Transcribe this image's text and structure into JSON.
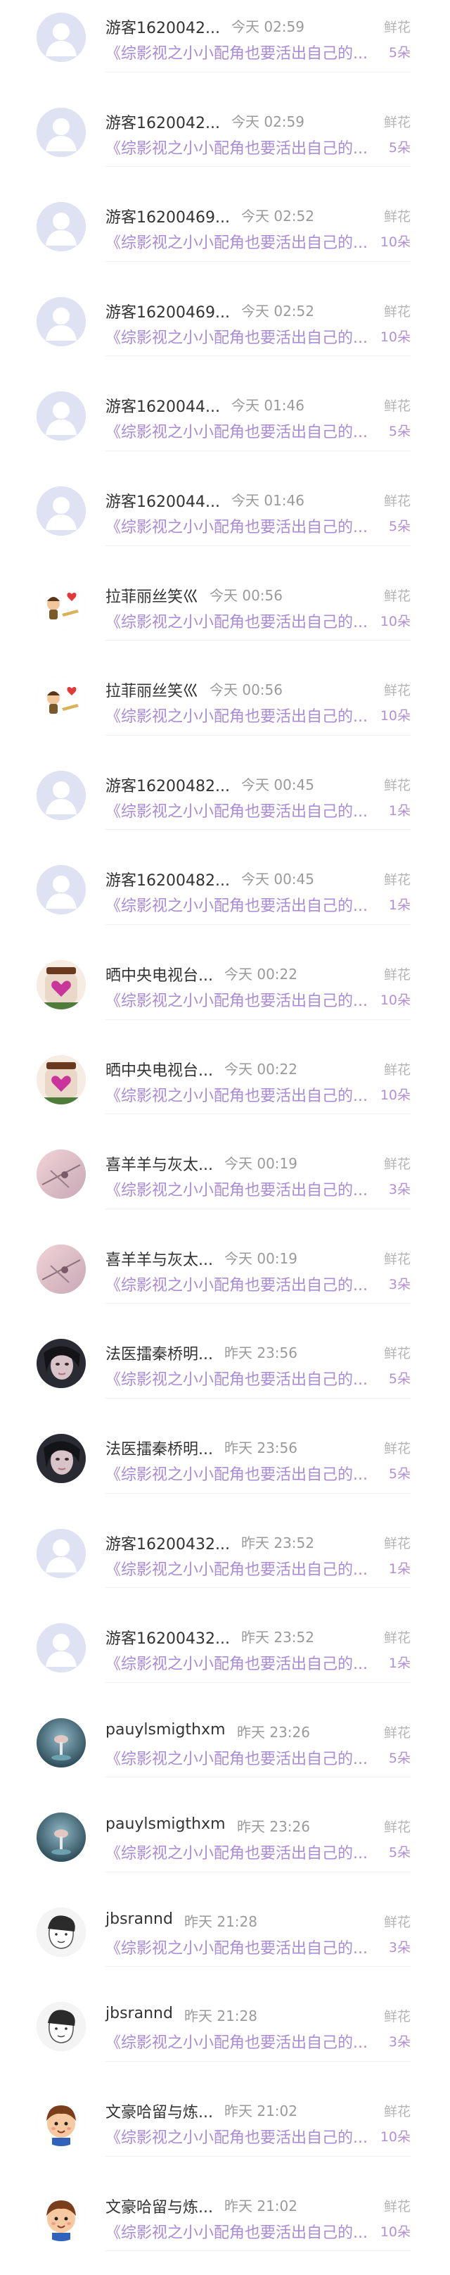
{
  "records": [
    {
      "name": "游客1620042...",
      "time": "今天 02:59",
      "gift": "鲜花",
      "book": "《综影视之小小配角也要活出自己的...",
      "count": "5朵",
      "avatar": "default-avatar-icon"
    },
    {
      "name": "游客1620042...",
      "time": "今天 02:59",
      "gift": "鲜花",
      "book": "《综影视之小小配角也要活出自己的...",
      "count": "5朵",
      "avatar": "default-avatar-icon"
    },
    {
      "name": "游客16200469...",
      "time": "今天 02:52",
      "gift": "鲜花",
      "book": "《综影视之小小配角也要活出自己的...",
      "count": "10朵",
      "avatar": "default-avatar-icon"
    },
    {
      "name": "游客16200469...",
      "time": "今天 02:52",
      "gift": "鲜花",
      "book": "《综影视之小小配角也要活出自己的...",
      "count": "10朵",
      "avatar": "default-avatar-icon"
    },
    {
      "name": "游客1620044...",
      "time": "今天 01:46",
      "gift": "鲜花",
      "book": "《综影视之小小配角也要活出自己的...",
      "count": "5朵",
      "avatar": "default-avatar-icon"
    },
    {
      "name": "游客1620044...",
      "time": "今天 01:46",
      "gift": "鲜花",
      "book": "《综影视之小小配角也要活出自己的...",
      "count": "5朵",
      "avatar": "default-avatar-icon"
    },
    {
      "name": "拉菲丽丝笑巛",
      "time": "今天 00:56",
      "gift": "鲜花",
      "book": "《综影视之小小配角也要活出自己的...",
      "count": "10朵",
      "avatar": "cartoon-couple-avatar"
    },
    {
      "name": "拉菲丽丝笑巛",
      "time": "今天 00:56",
      "gift": "鲜花",
      "book": "《综影视之小小配角也要活出自己的...",
      "count": "10朵",
      "avatar": "cartoon-couple-avatar"
    },
    {
      "name": "游客16200482...",
      "time": "今天 00:45",
      "gift": "鲜花",
      "book": "《综影视之小小配角也要活出自己的...",
      "count": "1朵",
      "avatar": "default-avatar-icon"
    },
    {
      "name": "游客16200482...",
      "time": "今天 00:45",
      "gift": "鲜花",
      "book": "《综影视之小小配角也要活出自己的...",
      "count": "1朵",
      "avatar": "default-avatar-icon"
    },
    {
      "name": "晒中央电视台...",
      "time": "今天 00:22",
      "gift": "鲜花",
      "book": "《综影视之小小配角也要活出自己的...",
      "count": "10朵",
      "avatar": "heart-jar-avatar"
    },
    {
      "name": "晒中央电视台...",
      "time": "今天 00:22",
      "gift": "鲜花",
      "book": "《综影视之小小配角也要活出自己的...",
      "count": "10朵",
      "avatar": "heart-jar-avatar"
    },
    {
      "name": "喜羊羊与灰太...",
      "time": "今天 00:19",
      "gift": "鲜花",
      "book": "《综影视之小小配角也要活出自己的...",
      "count": "3朵",
      "avatar": "pink-sky-avatar"
    },
    {
      "name": "喜羊羊与灰太...",
      "time": "今天 00:19",
      "gift": "鲜花",
      "book": "《综影视之小小配角也要活出自己的...",
      "count": "3朵",
      "avatar": "pink-sky-avatar"
    },
    {
      "name": "法医擂秦桥明...",
      "time": "昨天 23:56",
      "gift": "鲜花",
      "book": "《综影视之小小配角也要活出自己的...",
      "count": "5朵",
      "avatar": "dark-portrait-avatar"
    },
    {
      "name": "法医擂秦桥明...",
      "time": "昨天 23:56",
      "gift": "鲜花",
      "book": "《综影视之小小配角也要活出自己的...",
      "count": "5朵",
      "avatar": "dark-portrait-avatar"
    },
    {
      "name": "游客16200432...",
      "time": "昨天 23:52",
      "gift": "鲜花",
      "book": "《综影视之小小配角也要活出自己的...",
      "count": "1朵",
      "avatar": "default-avatar-icon"
    },
    {
      "name": "游客16200432...",
      "time": "昨天 23:52",
      "gift": "鲜花",
      "book": "《综影视之小小配角也要活出自己的...",
      "count": "1朵",
      "avatar": "default-avatar-icon"
    },
    {
      "name": "pauylsmigthxm",
      "time": "昨天 23:26",
      "gift": "鲜花",
      "book": "《综影视之小小配角也要活出自己的...",
      "count": "5朵",
      "avatar": "teal-photo-avatar"
    },
    {
      "name": "pauylsmigthxm",
      "time": "昨天 23:26",
      "gift": "鲜花",
      "book": "《综影视之小小配角也要活出自己的...",
      "count": "5朵",
      "avatar": "teal-photo-avatar"
    },
    {
      "name": "jbsrannd",
      "time": "昨天 21:28",
      "gift": "鲜花",
      "book": "《综影视之小小配角也要活出自己的...",
      "count": "3朵",
      "avatar": "sketch-face-avatar"
    },
    {
      "name": "jbsrannd",
      "time": "昨天 21:28",
      "gift": "鲜花",
      "book": "《综影视之小小配角也要活出自己的...",
      "count": "3朵",
      "avatar": "sketch-face-avatar"
    },
    {
      "name": "文豪哈留与炼...",
      "time": "昨天 21:02",
      "gift": "鲜花",
      "book": "《综影视之小小配角也要活出自己的...",
      "count": "10朵",
      "avatar": "cartoon-boy-avatar"
    },
    {
      "name": "文豪哈留与炼...",
      "time": "昨天 21:02",
      "gift": "鲜花",
      "book": "《综影视之小小配角也要活出自己的...",
      "count": "10朵",
      "avatar": "cartoon-boy-avatar"
    }
  ]
}
